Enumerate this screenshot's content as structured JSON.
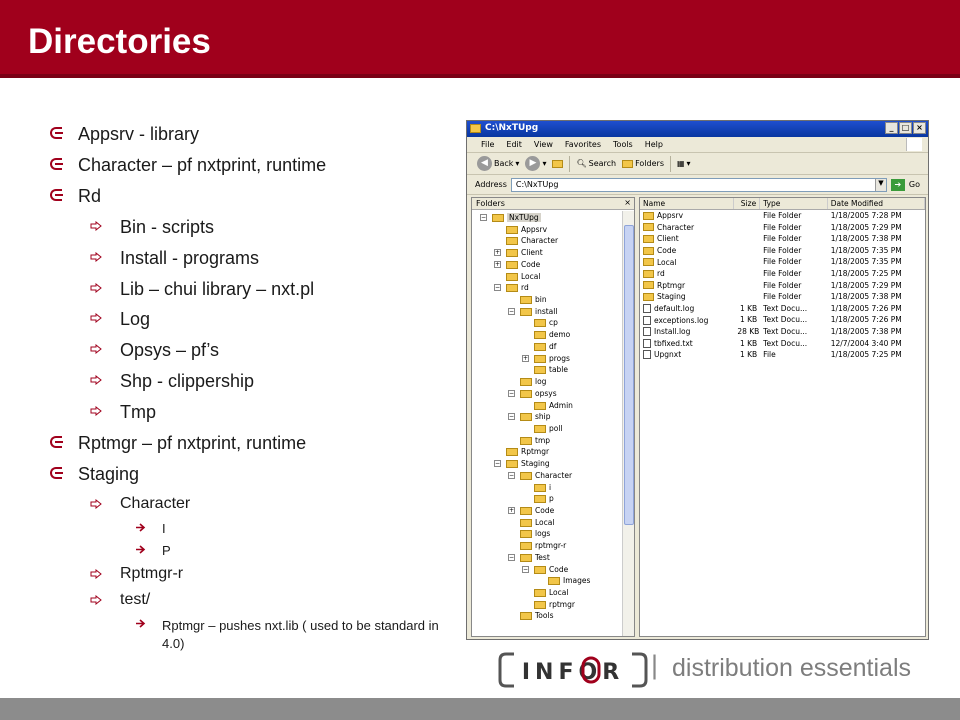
{
  "slide": {
    "title": "Directories",
    "colors": {
      "title_bg": "#a0001c",
      "footer": "#8c8c8c",
      "bullet_marker": "#a0001c"
    }
  },
  "bullets": [
    {
      "level": 1,
      "text": "Appsrv - library"
    },
    {
      "level": 1,
      "text": "Character – pf nxtprint, runtime"
    },
    {
      "level": 1,
      "text": "Rd"
    },
    {
      "level": 2,
      "text": "Bin - scripts"
    },
    {
      "level": 2,
      "text": "Install - programs"
    },
    {
      "level": 2,
      "text": "Lib – chui library – nxt.pl"
    },
    {
      "level": 2,
      "text": "Log"
    },
    {
      "level": 2,
      "text": "Opsys – pf’s"
    },
    {
      "level": 2,
      "text": "Shp - clippership"
    },
    {
      "level": 2,
      "text": "Tmp"
    },
    {
      "level": 1,
      "text": "Rptmgr – pf nxtprint, runtime"
    },
    {
      "level": 1,
      "text": "Staging"
    },
    {
      "level": 2,
      "text": "Character",
      "small": true
    },
    {
      "level": 3,
      "text": "I"
    },
    {
      "level": 3,
      "text": "P"
    },
    {
      "level": 2,
      "text": "Rptmgr-r",
      "small": true
    },
    {
      "level": 2,
      "text": "test/",
      "small": true
    },
    {
      "level": 3,
      "text": "Rptmgr – pushes nxt.lib ( used to be standard in 4.0)",
      "wrap": true
    }
  ],
  "explorer": {
    "title": "C:\\NxTUpg",
    "menu": [
      "File",
      "Edit",
      "View",
      "Favorites",
      "Tools",
      "Help"
    ],
    "toolbar": {
      "back": "Back",
      "search": "Search",
      "folders": "Folders"
    },
    "address_label": "Address",
    "address_value": "C:\\NxTUpg",
    "go_label": "Go",
    "folders_pane_title": "Folders",
    "tree": [
      {
        "label": "NxTUpg",
        "depth": 0,
        "exp": "−"
      },
      {
        "label": "Appsrv",
        "depth": 1,
        "exp": ""
      },
      {
        "label": "Character",
        "depth": 1,
        "exp": ""
      },
      {
        "label": "Client",
        "depth": 1,
        "exp": "+"
      },
      {
        "label": "Code",
        "depth": 1,
        "exp": "+"
      },
      {
        "label": "Local",
        "depth": 1,
        "exp": ""
      },
      {
        "label": "rd",
        "depth": 1,
        "exp": "−"
      },
      {
        "label": "bin",
        "depth": 2,
        "exp": ""
      },
      {
        "label": "install",
        "depth": 2,
        "exp": "−"
      },
      {
        "label": "cp",
        "depth": 3,
        "exp": ""
      },
      {
        "label": "demo",
        "depth": 3,
        "exp": ""
      },
      {
        "label": "df",
        "depth": 3,
        "exp": ""
      },
      {
        "label": "progs",
        "depth": 3,
        "exp": "+"
      },
      {
        "label": "table",
        "depth": 3,
        "exp": ""
      },
      {
        "label": "log",
        "depth": 2,
        "exp": ""
      },
      {
        "label": "opsys",
        "depth": 2,
        "exp": "−"
      },
      {
        "label": "Admin",
        "depth": 3,
        "exp": ""
      },
      {
        "label": "ship",
        "depth": 2,
        "exp": "−"
      },
      {
        "label": "poll",
        "depth": 3,
        "exp": ""
      },
      {
        "label": "tmp",
        "depth": 2,
        "exp": ""
      },
      {
        "label": "Rptmgr",
        "depth": 1,
        "exp": ""
      },
      {
        "label": "Staging",
        "depth": 1,
        "exp": "−"
      },
      {
        "label": "Character",
        "depth": 2,
        "exp": "−"
      },
      {
        "label": "i",
        "depth": 3,
        "exp": ""
      },
      {
        "label": "p",
        "depth": 3,
        "exp": ""
      },
      {
        "label": "Code",
        "depth": 2,
        "exp": "+"
      },
      {
        "label": "Local",
        "depth": 2,
        "exp": ""
      },
      {
        "label": "logs",
        "depth": 2,
        "exp": ""
      },
      {
        "label": "rptmgr-r",
        "depth": 2,
        "exp": ""
      },
      {
        "label": "Test",
        "depth": 2,
        "exp": "−"
      },
      {
        "label": "Code",
        "depth": 3,
        "exp": "−"
      },
      {
        "label": "Images",
        "depth": 4,
        "exp": ""
      },
      {
        "label": "Local",
        "depth": 3,
        "exp": ""
      },
      {
        "label": "rptmgr",
        "depth": 3,
        "exp": ""
      },
      {
        "label": "Tools",
        "depth": 2,
        "exp": ""
      }
    ],
    "columns": [
      "Name",
      "Size",
      "Type",
      "Date Modified"
    ],
    "files": [
      {
        "icon": "folder",
        "name": "Appsrv",
        "size": "",
        "type": "File Folder",
        "date": "1/18/2005 7:28 PM"
      },
      {
        "icon": "folder",
        "name": "Character",
        "size": "",
        "type": "File Folder",
        "date": "1/18/2005 7:29 PM"
      },
      {
        "icon": "folder",
        "name": "Client",
        "size": "",
        "type": "File Folder",
        "date": "1/18/2005 7:38 PM"
      },
      {
        "icon": "folder",
        "name": "Code",
        "size": "",
        "type": "File Folder",
        "date": "1/18/2005 7:35 PM"
      },
      {
        "icon": "folder",
        "name": "Local",
        "size": "",
        "type": "File Folder",
        "date": "1/18/2005 7:35 PM"
      },
      {
        "icon": "folder",
        "name": "rd",
        "size": "",
        "type": "File Folder",
        "date": "1/18/2005 7:25 PM"
      },
      {
        "icon": "folder",
        "name": "Rptmgr",
        "size": "",
        "type": "File Folder",
        "date": "1/18/2005 7:29 PM"
      },
      {
        "icon": "folder",
        "name": "Staging",
        "size": "",
        "type": "File Folder",
        "date": "1/18/2005 7:38 PM"
      },
      {
        "icon": "doc",
        "name": "default.log",
        "size": "1 KB",
        "type": "Text Docu...",
        "date": "1/18/2005 7:26 PM"
      },
      {
        "icon": "doc",
        "name": "exceptions.log",
        "size": "1 KB",
        "type": "Text Docu...",
        "date": "1/18/2005 7:26 PM"
      },
      {
        "icon": "doc",
        "name": "Install.log",
        "size": "28 KB",
        "type": "Text Docu...",
        "date": "1/18/2005 7:38 PM"
      },
      {
        "icon": "doc",
        "name": "tbfixed.txt",
        "size": "1 KB",
        "type": "Text Docu...",
        "date": "12/7/2004 3:40 PM"
      },
      {
        "icon": "doc",
        "name": "Upgnxt",
        "size": "1 KB",
        "type": "File",
        "date": "1/18/2005 7:25 PM"
      }
    ]
  },
  "footer": {
    "logo_text": "INFOR",
    "separator": "|",
    "tagline": "distribution essentials"
  }
}
